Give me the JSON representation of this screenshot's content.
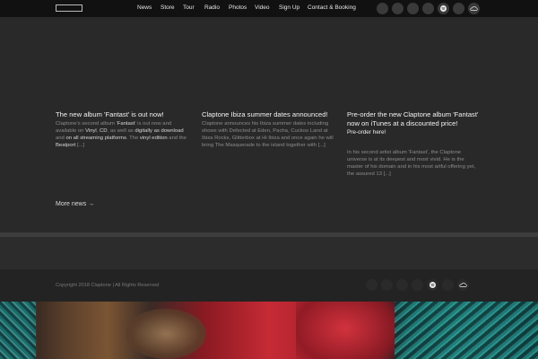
{
  "nav": {
    "items": [
      "News",
      "Store",
      "Tour",
      "Radio",
      "Photos",
      "Video",
      "Sign Up",
      "Contact & Booking"
    ]
  },
  "social_icons": [
    "facebook-icon",
    "twitter-icon",
    "instagram-icon",
    "youtube-icon",
    "spotify-icon",
    "apple-music-icon",
    "soundcloud-icon"
  ],
  "news": [
    {
      "title": "The new album 'Fantast' is out now!",
      "body_parts": [
        {
          "t": "Claptone's second album '",
          "b": false
        },
        {
          "t": "Fantast",
          "b": true
        },
        {
          "t": "' is out now and available on ",
          "b": false
        },
        {
          "t": "Vinyl",
          "b": true
        },
        {
          "t": ", ",
          "b": false
        },
        {
          "t": "CD",
          "b": true
        },
        {
          "t": ", as well as ",
          "b": false
        },
        {
          "t": "digitally as download",
          "b": true
        },
        {
          "t": " and ",
          "b": false
        },
        {
          "t": "on all streaming platforms",
          "b": true
        },
        {
          "t": ". The ",
          "b": false
        },
        {
          "t": "vinyl edition",
          "b": true
        },
        {
          "t": " and the ",
          "b": false
        },
        {
          "t": "Beatport",
          "b": true
        },
        {
          "t": " [...]",
          "b": false
        }
      ]
    },
    {
      "title": "Claptone Ibiza summer dates announced!",
      "body": "Claptone announces his Ibiza summer dates including shows with Defected at Eden, Pacha, Cuckoo Land at Ibiza Rocks, Glitterbox at Hi Ibiza and once again he will bring The Masquerade to the island together with [...]"
    },
    {
      "title": "Pre-order the new Claptone album 'Fantast' now on iTunes at a discounted price!",
      "preorder": "Pre-order here!",
      "body": "In his second artist album 'Fantast', the Claptone universe is at its deepest and most vivid. He is the master of his domain and in his most artful offering yet, the assured 13 [...]"
    }
  ],
  "more_news": "More news →",
  "footer": {
    "copyright": "Copyright 2018 Claptone | All Rights Reserved"
  },
  "colors": {
    "background": "#262626",
    "topbar": "#111111",
    "accent_text": "#f2f2f2"
  }
}
